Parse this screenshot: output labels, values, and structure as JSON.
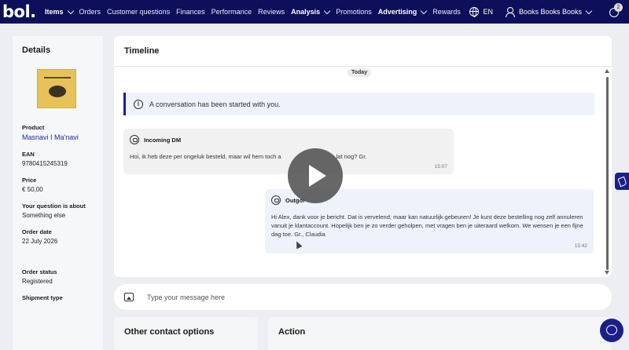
{
  "brand": {
    "logo": "bol."
  },
  "nav": {
    "items": [
      {
        "label": "Items",
        "bold": true,
        "dropdown": true
      },
      {
        "label": "Orders",
        "bold": false,
        "dropdown": false
      },
      {
        "label": "Customer questions",
        "bold": false,
        "dropdown": false
      },
      {
        "label": "Finances",
        "bold": false,
        "dropdown": false
      },
      {
        "label": "Performance",
        "bold": false,
        "dropdown": false
      },
      {
        "label": "Reviews",
        "bold": false,
        "dropdown": false
      },
      {
        "label": "Analysis",
        "bold": true,
        "dropdown": true
      },
      {
        "label": "Promotions",
        "bold": false,
        "dropdown": false
      },
      {
        "label": "Advertising",
        "bold": true,
        "dropdown": true
      },
      {
        "label": "Rewards",
        "bold": false,
        "dropdown": false
      }
    ],
    "language": "EN",
    "account": "Books Books Books",
    "notifications_count": "2"
  },
  "details": {
    "title": "Details",
    "product_label": "Product",
    "product_value": "Masnavi I Ma'navi",
    "ean_label": "EAN",
    "ean_value": "9780415245319",
    "price_label": "Price",
    "price_value": "€ 50,00",
    "question_label": "Your question is about",
    "question_value": "Something else",
    "order_date_label": "Order date",
    "order_date_value": "22 July 2026",
    "order_status_label": "Order status",
    "order_status_value": "Registered",
    "shipment_label": "Shipment type"
  },
  "timeline": {
    "title": "Timeline",
    "day_label": "Today",
    "notice": "A conversation has been started with you.",
    "incoming": {
      "title": "Incoming DM",
      "text": "Hoi, ik heb deze per ongeluk besteld, maar wil hem toch a",
      "text_tail": "lat nog? Gr.",
      "time": "15:07"
    },
    "outgoing": {
      "title": "Outgoi",
      "text": "Hi Alex, dank voor je bericht. Dat is vervelend, maar kan natuurlijk gebeuren! Je kunt deze bestelling nog zelf annuleren vanuit je klantaccount. Hopelijk ben je zo verder geholpen, met vragen ben je uiteraard welkom. We wensen je een fijne dag toe. Gr., Claudia",
      "time": "15:42"
    }
  },
  "composer": {
    "placeholder": "Type your message here"
  },
  "cards": {
    "other_contact": "Other contact options",
    "action": "Action"
  },
  "colors": {
    "nav_bg": "#0d0f5a",
    "accent": "#1b1f8a",
    "notice_bg": "#eef2fb",
    "incoming_bg": "#f1f1f1"
  }
}
